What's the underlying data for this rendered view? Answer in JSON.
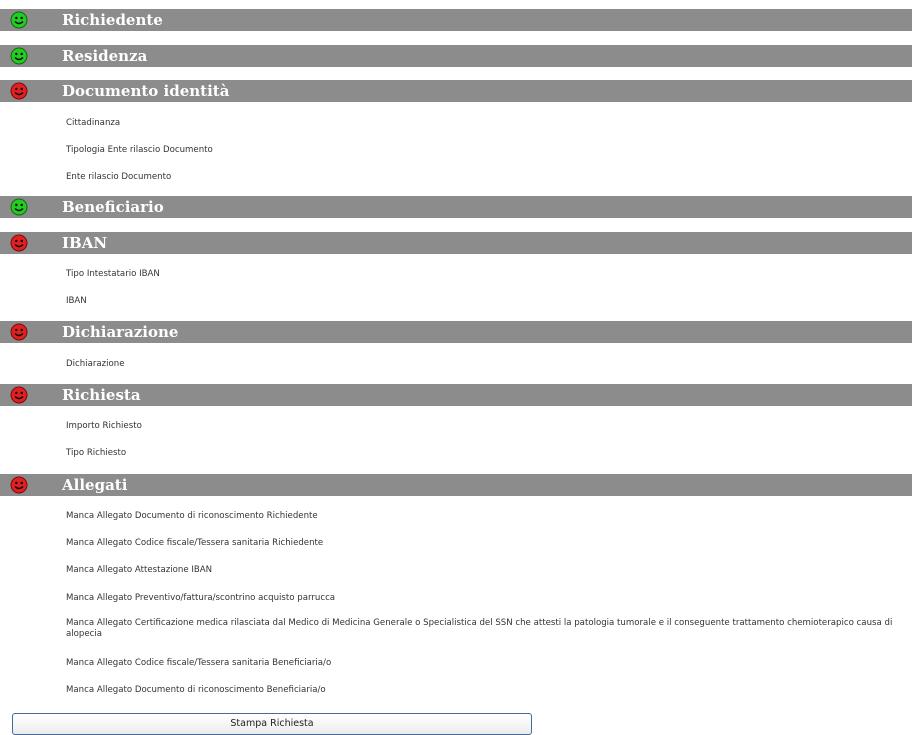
{
  "colors": {
    "section_bar": "#8c8c8c",
    "status_ok": "#22cc22",
    "status_error": "#e02020"
  },
  "sections": [
    {
      "title": "Richiedente",
      "status": "ok",
      "status_icon": "smiley-green-icon",
      "items": []
    },
    {
      "title": "Residenza",
      "status": "ok",
      "status_icon": "smiley-green-icon",
      "items": []
    },
    {
      "title": "Documento identità",
      "status": "error",
      "status_icon": "smiley-red-icon",
      "items": [
        "Cittadinanza",
        "Tipologia Ente rilascio Documento",
        "Ente rilascio Documento"
      ]
    },
    {
      "title": "Beneficiario",
      "status": "ok",
      "status_icon": "smiley-green-icon",
      "items": []
    },
    {
      "title": "IBAN",
      "status": "error",
      "status_icon": "smiley-red-icon",
      "items": [
        "Tipo Intestatario IBAN",
        "IBAN"
      ]
    },
    {
      "title": "Dichiarazione",
      "status": "error",
      "status_icon": "smiley-red-icon",
      "items": [
        "Dichiarazione"
      ]
    },
    {
      "title": "Richiesta",
      "status": "error",
      "status_icon": "smiley-red-icon",
      "items": [
        "Importo Richiesto",
        "Tipo Richiesto"
      ]
    },
    {
      "title": "Allegati",
      "status": "error",
      "status_icon": "smiley-red-icon",
      "items": [
        "Manca Allegato Documento di riconoscimento Richiedente",
        "Manca Allegato Codice fiscale/Tessera sanitaria Richiedente",
        "Manca Allegato Attestazione IBAN",
        "Manca Allegato Preventivo/fattura/scontrino acquisto parrucca",
        "Manca Allegato Certificazione medica rilasciata dal Medico di Medicina Generale o Specialistica del SSN che attesti la patologia tumorale e il conseguente trattamento chemioterapico causa di alopecia",
        "Manca Allegato Codice fiscale/Tessera sanitaria Beneficiaria/o",
        "Manca Allegato Documento di riconoscimento Beneficiaria/o"
      ]
    }
  ],
  "print_button_label": "Stampa Richiesta"
}
